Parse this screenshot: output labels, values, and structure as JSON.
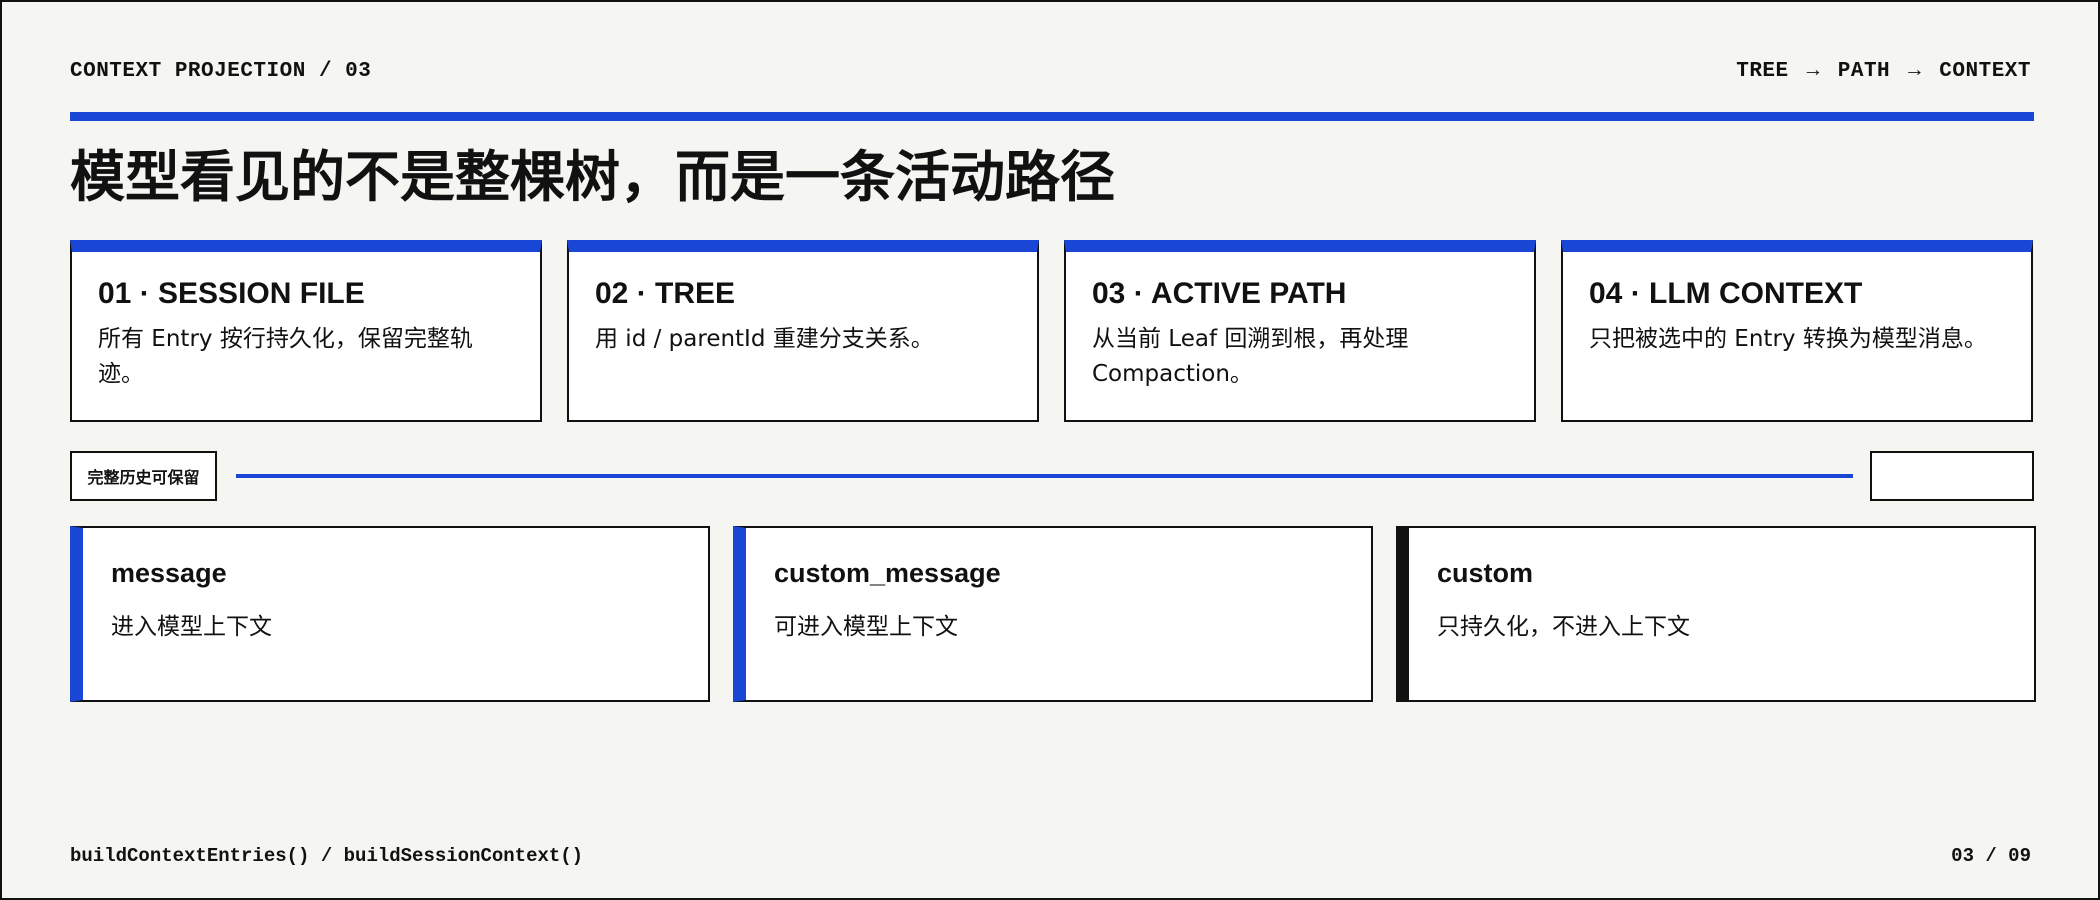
{
  "header": {
    "section_label": "CONTEXT PROJECTION / 03",
    "flow": [
      "TREE",
      "→",
      "PATH",
      "→",
      "CONTEXT"
    ]
  },
  "title": "模型看见的不是整棵树，而是一条活动路径",
  "steps": [
    {
      "title": "01 · SESSION FILE",
      "desc": "所有 Entry 按行持久化，保留完整轨迹。"
    },
    {
      "title": "02 · TREE",
      "desc": "用 id / parentId 重建分支关系。"
    },
    {
      "title": "03 · ACTIVE PATH",
      "desc": "从当前 Leaf 回溯到根，再处理 Compaction。"
    },
    {
      "title": "04 · LLM CONTEXT",
      "desc": "只把被选中的 Entry 转换为模型消息。"
    }
  ],
  "timeline": {
    "left_label": "完整历史可保留",
    "right_label": ""
  },
  "entry_types": [
    {
      "name": "message",
      "desc": "进入模型上下文",
      "accent": "#1a46d6"
    },
    {
      "name": "custom_message",
      "desc": "可进入模型上下文",
      "accent": "#1a46d6"
    },
    {
      "name": "custom",
      "desc": "只持久化，不进入上下文",
      "accent": "#111111"
    }
  ],
  "footer": {
    "functions": "buildContextEntries() / buildSessionContext()",
    "page": "03 / 09"
  },
  "colors": {
    "accent": "#1a46d6",
    "background": "#f5f5f1",
    "ink": "#111111"
  }
}
